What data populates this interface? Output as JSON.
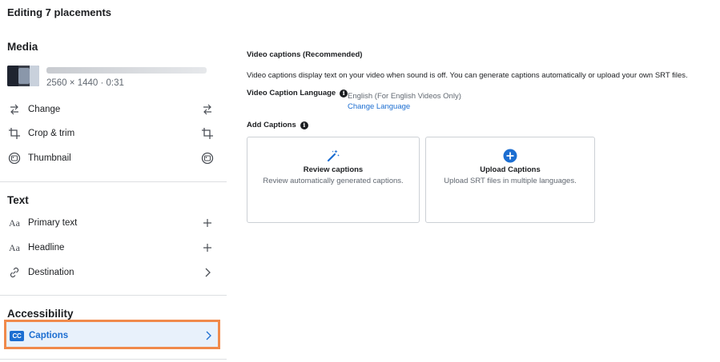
{
  "header": {
    "title": "Editing 7 placements"
  },
  "media": {
    "heading": "Media",
    "meta": "2560 × 1440 · 0:31",
    "actions": [
      {
        "label": "Change",
        "icon": "swap-icon"
      },
      {
        "label": "Crop & trim",
        "icon": "crop-icon"
      },
      {
        "label": "Thumbnail",
        "icon": "thumbnail-icon"
      }
    ]
  },
  "text_section": {
    "heading": "Text",
    "items": [
      {
        "label": "Primary text",
        "icon": "text-aa-icon"
      },
      {
        "label": "Headline",
        "icon": "text-aa-icon"
      },
      {
        "label": "Destination",
        "icon": "link-icon"
      }
    ]
  },
  "accessibility": {
    "heading": "Accessibility",
    "captions_label": "Captions",
    "captions_badge": "CC",
    "highlight_color": "#f08a4b"
  },
  "captions_panel": {
    "title": "Video captions (Recommended)",
    "description": "Video captions display text on your video when sound is off. You can generate captions automatically or upload your own SRT files.",
    "language_label": "Video Caption Language",
    "language_value": "English (For English Videos Only)",
    "change_language": "Change Language",
    "add_label": "Add Captions",
    "info_glyph": "i",
    "cards": [
      {
        "title": "Review captions",
        "desc": "Review automatically generated captions.",
        "icon": "magic-wand-icon"
      },
      {
        "title": "Upload Captions",
        "desc": "Upload SRT files in multiple languages.",
        "icon": "plus-circle-icon"
      }
    ]
  },
  "colors": {
    "accent": "#1c6ed1",
    "highlight": "#f08a4b",
    "divider": "#dddfe2"
  }
}
